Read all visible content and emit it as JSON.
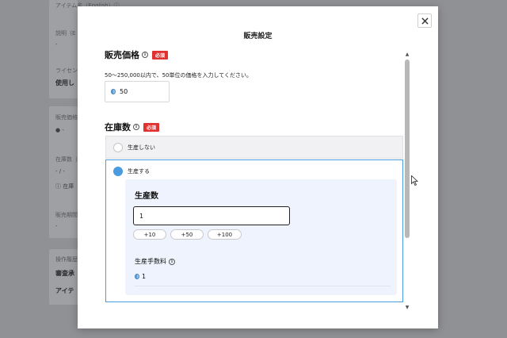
{
  "background": {
    "items": [
      {
        "text": "アイテム名（English）ⓘ",
        "style": "light"
      },
      {
        "text": "説明（E",
        "style": "light"
      },
      {
        "text": "-",
        "style": "normal"
      },
      {
        "text": "ライセン",
        "style": "light"
      },
      {
        "text": "使用し",
        "style": "bold"
      },
      {
        "text": "販売価格",
        "style": "light"
      },
      {
        "text": "● -",
        "style": "normal"
      },
      {
        "text": "在庫数（",
        "style": "light"
      },
      {
        "text": "- / -",
        "style": "normal"
      },
      {
        "text": "ⓘ 在庫",
        "style": "normal"
      },
      {
        "text": "販売期間",
        "style": "light"
      },
      {
        "text": "-",
        "style": "normal"
      },
      {
        "text": "操作履歴",
        "style": "light"
      },
      {
        "text": "審査承",
        "style": "bold"
      },
      {
        "text": "アイテ",
        "style": "bold"
      }
    ]
  },
  "modal": {
    "title": "販売設定",
    "close_icon": "close-icon",
    "price": {
      "heading": "販売価格",
      "info_icon": "info-icon",
      "required_badge": "必須",
      "help_text": "50〜250,000以内で、50単位の価格を入力してください。",
      "value": "50",
      "currency_icon": "coin-icon"
    },
    "stock": {
      "heading": "在庫数",
      "info_icon": "info-icon",
      "required_badge": "必須",
      "options": [
        {
          "label": "生産しない",
          "selected": false
        },
        {
          "label": "生産する",
          "selected": true
        }
      ],
      "production": {
        "title": "生産数",
        "quantity": "1",
        "steps": [
          "+10",
          "+50",
          "+100"
        ],
        "fee_label": "生産手数料",
        "fee_value": "1"
      }
    }
  },
  "colors": {
    "accent": "#4a9be0",
    "required": "#e13232",
    "panel_bg": "#eef3fd"
  }
}
